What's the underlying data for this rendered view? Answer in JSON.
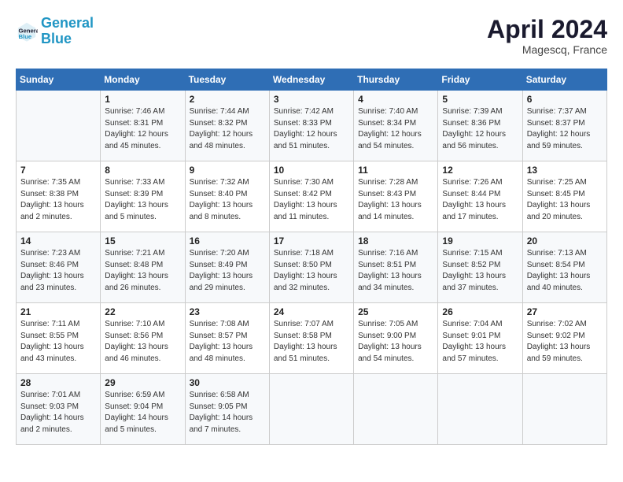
{
  "header": {
    "logo_line1": "General",
    "logo_line2": "Blue",
    "title": "April 2024",
    "subtitle": "Magescq, France"
  },
  "days_of_week": [
    "Sunday",
    "Monday",
    "Tuesday",
    "Wednesday",
    "Thursday",
    "Friday",
    "Saturday"
  ],
  "weeks": [
    [
      {
        "day": "",
        "info": ""
      },
      {
        "day": "1",
        "info": "Sunrise: 7:46 AM\nSunset: 8:31 PM\nDaylight: 12 hours\nand 45 minutes."
      },
      {
        "day": "2",
        "info": "Sunrise: 7:44 AM\nSunset: 8:32 PM\nDaylight: 12 hours\nand 48 minutes."
      },
      {
        "day": "3",
        "info": "Sunrise: 7:42 AM\nSunset: 8:33 PM\nDaylight: 12 hours\nand 51 minutes."
      },
      {
        "day": "4",
        "info": "Sunrise: 7:40 AM\nSunset: 8:34 PM\nDaylight: 12 hours\nand 54 minutes."
      },
      {
        "day": "5",
        "info": "Sunrise: 7:39 AM\nSunset: 8:36 PM\nDaylight: 12 hours\nand 56 minutes."
      },
      {
        "day": "6",
        "info": "Sunrise: 7:37 AM\nSunset: 8:37 PM\nDaylight: 12 hours\nand 59 minutes."
      }
    ],
    [
      {
        "day": "7",
        "info": "Sunrise: 7:35 AM\nSunset: 8:38 PM\nDaylight: 13 hours\nand 2 minutes."
      },
      {
        "day": "8",
        "info": "Sunrise: 7:33 AM\nSunset: 8:39 PM\nDaylight: 13 hours\nand 5 minutes."
      },
      {
        "day": "9",
        "info": "Sunrise: 7:32 AM\nSunset: 8:40 PM\nDaylight: 13 hours\nand 8 minutes."
      },
      {
        "day": "10",
        "info": "Sunrise: 7:30 AM\nSunset: 8:42 PM\nDaylight: 13 hours\nand 11 minutes."
      },
      {
        "day": "11",
        "info": "Sunrise: 7:28 AM\nSunset: 8:43 PM\nDaylight: 13 hours\nand 14 minutes."
      },
      {
        "day": "12",
        "info": "Sunrise: 7:26 AM\nSunset: 8:44 PM\nDaylight: 13 hours\nand 17 minutes."
      },
      {
        "day": "13",
        "info": "Sunrise: 7:25 AM\nSunset: 8:45 PM\nDaylight: 13 hours\nand 20 minutes."
      }
    ],
    [
      {
        "day": "14",
        "info": "Sunrise: 7:23 AM\nSunset: 8:46 PM\nDaylight: 13 hours\nand 23 minutes."
      },
      {
        "day": "15",
        "info": "Sunrise: 7:21 AM\nSunset: 8:48 PM\nDaylight: 13 hours\nand 26 minutes."
      },
      {
        "day": "16",
        "info": "Sunrise: 7:20 AM\nSunset: 8:49 PM\nDaylight: 13 hours\nand 29 minutes."
      },
      {
        "day": "17",
        "info": "Sunrise: 7:18 AM\nSunset: 8:50 PM\nDaylight: 13 hours\nand 32 minutes."
      },
      {
        "day": "18",
        "info": "Sunrise: 7:16 AM\nSunset: 8:51 PM\nDaylight: 13 hours\nand 34 minutes."
      },
      {
        "day": "19",
        "info": "Sunrise: 7:15 AM\nSunset: 8:52 PM\nDaylight: 13 hours\nand 37 minutes."
      },
      {
        "day": "20",
        "info": "Sunrise: 7:13 AM\nSunset: 8:54 PM\nDaylight: 13 hours\nand 40 minutes."
      }
    ],
    [
      {
        "day": "21",
        "info": "Sunrise: 7:11 AM\nSunset: 8:55 PM\nDaylight: 13 hours\nand 43 minutes."
      },
      {
        "day": "22",
        "info": "Sunrise: 7:10 AM\nSunset: 8:56 PM\nDaylight: 13 hours\nand 46 minutes."
      },
      {
        "day": "23",
        "info": "Sunrise: 7:08 AM\nSunset: 8:57 PM\nDaylight: 13 hours\nand 48 minutes."
      },
      {
        "day": "24",
        "info": "Sunrise: 7:07 AM\nSunset: 8:58 PM\nDaylight: 13 hours\nand 51 minutes."
      },
      {
        "day": "25",
        "info": "Sunrise: 7:05 AM\nSunset: 9:00 PM\nDaylight: 13 hours\nand 54 minutes."
      },
      {
        "day": "26",
        "info": "Sunrise: 7:04 AM\nSunset: 9:01 PM\nDaylight: 13 hours\nand 57 minutes."
      },
      {
        "day": "27",
        "info": "Sunrise: 7:02 AM\nSunset: 9:02 PM\nDaylight: 13 hours\nand 59 minutes."
      }
    ],
    [
      {
        "day": "28",
        "info": "Sunrise: 7:01 AM\nSunset: 9:03 PM\nDaylight: 14 hours\nand 2 minutes."
      },
      {
        "day": "29",
        "info": "Sunrise: 6:59 AM\nSunset: 9:04 PM\nDaylight: 14 hours\nand 5 minutes."
      },
      {
        "day": "30",
        "info": "Sunrise: 6:58 AM\nSunset: 9:05 PM\nDaylight: 14 hours\nand 7 minutes."
      },
      {
        "day": "",
        "info": ""
      },
      {
        "day": "",
        "info": ""
      },
      {
        "day": "",
        "info": ""
      },
      {
        "day": "",
        "info": ""
      }
    ]
  ]
}
